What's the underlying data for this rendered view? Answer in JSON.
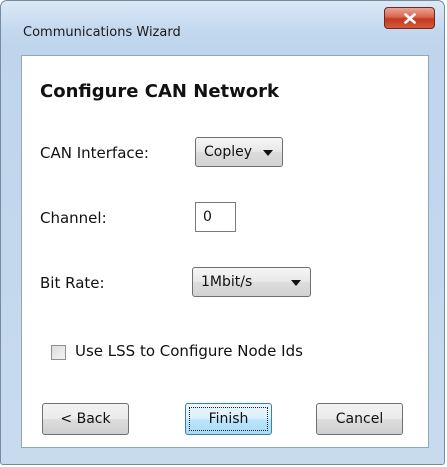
{
  "window": {
    "title": "Communications Wizard"
  },
  "page": {
    "heading": "Configure CAN Network"
  },
  "fields": {
    "can_interface": {
      "label": "CAN Interface:",
      "value": "Copley"
    },
    "channel": {
      "label": "Channel:",
      "value": "0"
    },
    "bit_rate": {
      "label": "Bit Rate:",
      "value": "1Mbit/s"
    },
    "use_lss": {
      "label": "Use LSS to Configure Node Ids",
      "checked": false
    }
  },
  "buttons": {
    "back": "< Back",
    "finish": "Finish",
    "cancel": "Cancel"
  },
  "icons": {
    "close": "close-icon",
    "dropdown": "chevron-down-icon"
  },
  "colors": {
    "close_button": "#c2391f",
    "frame": "#c4d9ef",
    "default_button": "#bee6fd"
  }
}
